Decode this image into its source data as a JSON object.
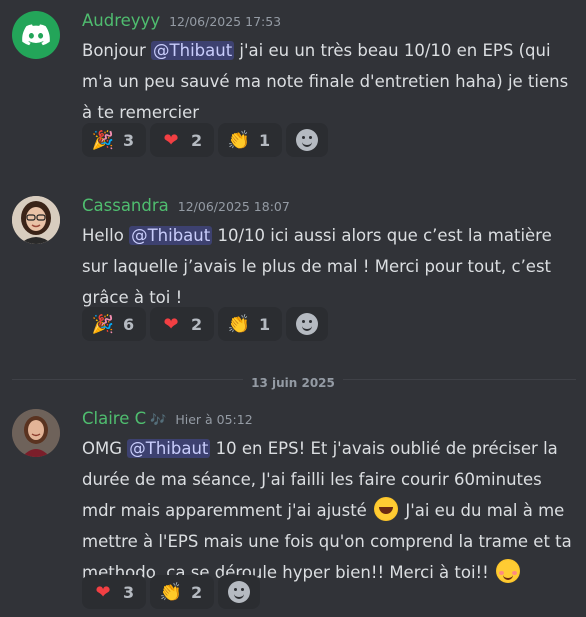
{
  "messages": [
    {
      "username": "Audreyyy",
      "timestamp": "12/06/2025 17:53",
      "avatar_icon": "discord-logo-icon",
      "content": {
        "before": "Bonjour ",
        "mention": "@Thibaut",
        "after": " j'ai eu un très beau 10/10 en EPS (qui m'a un peu sauvé ma note finale d'entretien haha) je tiens à te remercier"
      },
      "reactions": [
        {
          "emoji": "🎉",
          "count": "3"
        },
        {
          "emoji": "❤",
          "count": "2"
        },
        {
          "emoji": "👏",
          "count": "1"
        }
      ]
    },
    {
      "username": "Cassandra",
      "timestamp": "12/06/2025 18:07",
      "content": {
        "before": "Hello ",
        "mention": "@Thibaut",
        "after": " 10/10 ici aussi alors que c’est la matière sur laquelle j’avais le plus de mal ! Merci pour tout, c’est grâce à toi !"
      },
      "reactions": [
        {
          "emoji": "🎉",
          "count": "6"
        },
        {
          "emoji": "❤",
          "count": "2"
        },
        {
          "emoji": "👏",
          "count": "1"
        }
      ]
    },
    {
      "username": "Claire C",
      "username_icon": "🎶",
      "timestamp": "Hier à 05:12",
      "content": {
        "before": "OMG ",
        "mention": "@Thibaut",
        "after_part1": " 10 en EPS! Et j'avais oublié de préciser la durée de ma séance, J'ai failli les faire courir 60minutes mdr mais apparemment j'ai ajusté ",
        "after_part2": " J'ai eu du mal à me mettre à l'EPS mais une fois qu'on comprend la trame et ta methodo, ca se déroule hyper bien!! Merci à toi!! "
      },
      "reactions": [
        {
          "emoji": "❤",
          "count": "3"
        },
        {
          "emoji": "👏",
          "count": "2"
        }
      ]
    }
  ],
  "date_divider": "13 juin 2025",
  "colors": {
    "background": "#313338",
    "username": "#4fbd6f",
    "mention_bg": "#3c4270",
    "reaction_bg": "#2b2d31"
  }
}
